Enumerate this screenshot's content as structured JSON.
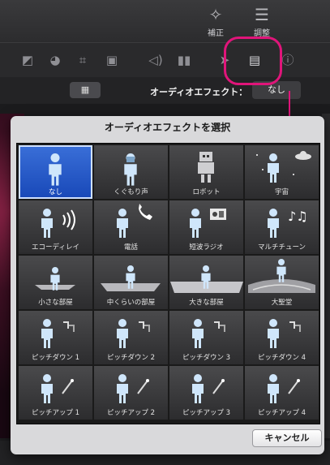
{
  "toolbar": {
    "enhance_label": "補正",
    "adjust_label": "調整"
  },
  "iconbar": {
    "items": [
      "color-balance-icon",
      "color-correction-icon",
      "crop-icon",
      "stabilization-icon",
      "volume-icon",
      "equalizer-icon",
      "noise-reduction-icon",
      "video-audio-effects-icon",
      "info-icon"
    ]
  },
  "effectbar": {
    "label": "オーディオエフェクト：",
    "value": "なし"
  },
  "popover": {
    "title": "オーディオエフェクトを選択",
    "cancel_label": "キャンセル",
    "effects": [
      {
        "label": "なし",
        "icon": "person-icon",
        "selected": true
      },
      {
        "label": "くぐもり声",
        "icon": "muffled-person-icon",
        "selected": false
      },
      {
        "label": "ロボット",
        "icon": "robot-icon",
        "selected": false
      },
      {
        "label": "宇宙",
        "icon": "space-icon",
        "selected": false
      },
      {
        "label": "エコーディレイ",
        "icon": "echo-icon",
        "selected": false
      },
      {
        "label": "電話",
        "icon": "telephone-icon",
        "selected": false
      },
      {
        "label": "短波ラジオ",
        "icon": "radio-icon",
        "selected": false
      },
      {
        "label": "マルチチューン",
        "icon": "music-notes-icon",
        "selected": false
      },
      {
        "label": "小さな部屋",
        "icon": "small-room-icon",
        "selected": false
      },
      {
        "label": "中くらいの部屋",
        "icon": "medium-room-icon",
        "selected": false
      },
      {
        "label": "大きな部屋",
        "icon": "large-room-icon",
        "selected": false
      },
      {
        "label": "大聖堂",
        "icon": "cathedral-icon",
        "selected": false
      },
      {
        "label": "ピッチダウン 1",
        "icon": "pitch-down-icon",
        "selected": false
      },
      {
        "label": "ピッチダウン 2",
        "icon": "pitch-down-icon",
        "selected": false
      },
      {
        "label": "ピッチダウン 3",
        "icon": "pitch-down-icon",
        "selected": false
      },
      {
        "label": "ピッチダウン 4",
        "icon": "pitch-down-icon",
        "selected": false
      },
      {
        "label": "ピッチアップ 1",
        "icon": "pitch-up-icon",
        "selected": false
      },
      {
        "label": "ピッチアップ 2",
        "icon": "pitch-up-icon",
        "selected": false
      },
      {
        "label": "ピッチアップ 3",
        "icon": "pitch-up-icon",
        "selected": false
      },
      {
        "label": "ピッチアップ 4",
        "icon": "pitch-up-icon",
        "selected": false
      }
    ]
  },
  "colors": {
    "annotation": "#e0157a",
    "selection": "#1848b8"
  }
}
